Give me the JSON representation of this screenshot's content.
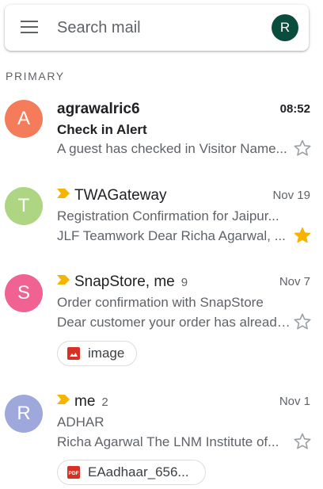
{
  "search": {
    "placeholder": "Search mail",
    "account_initial": "R"
  },
  "section": {
    "label": "PRIMARY"
  },
  "mails": [
    {
      "initial": "A",
      "avatar_color": "#f57c5b",
      "sender": "agrawalric6",
      "count": "",
      "date": "08:52",
      "subject": "Check in Alert",
      "snippet": "A guest has checked in Visitor Name...",
      "starred": false,
      "unread": true,
      "important": false
    },
    {
      "initial": "T",
      "avatar_color": "#aed581",
      "sender": "TWAGateway",
      "count": "",
      "date": "Nov 19",
      "subject": "Registration Confirmation for Jaipur...",
      "snippet": "JLF Teamwork Dear Richa Agarwal, ...",
      "starred": true,
      "unread": false,
      "important": true
    },
    {
      "initial": "S",
      "avatar_color": "#f06292",
      "sender": "SnapStore, me",
      "count": "9",
      "date": "Nov 7",
      "subject": "Order confirmation with SnapStore",
      "snippet": "Dear customer your order has already...",
      "starred": false,
      "unread": false,
      "important": true,
      "attachment": {
        "label": "image",
        "icon": "image-icon",
        "icon_color": "#d93025"
      }
    },
    {
      "initial": "R",
      "avatar_color": "#9fa8da",
      "sender": "me",
      "count": "2",
      "date": "Nov 1",
      "subject": "ADHAR",
      "snippet": "Richa Agarwal The LNM Institute of...",
      "starred": false,
      "unread": false,
      "important": true,
      "attachment": {
        "label": "EAadhaar_656...",
        "icon": "pdf-icon",
        "icon_color": "#d93025"
      }
    }
  ],
  "colors": {
    "importance": "#f5b400",
    "star_filled": "#f5b400",
    "star_empty": "#9aa0a6",
    "account_avatar": "#0b4d3c"
  }
}
